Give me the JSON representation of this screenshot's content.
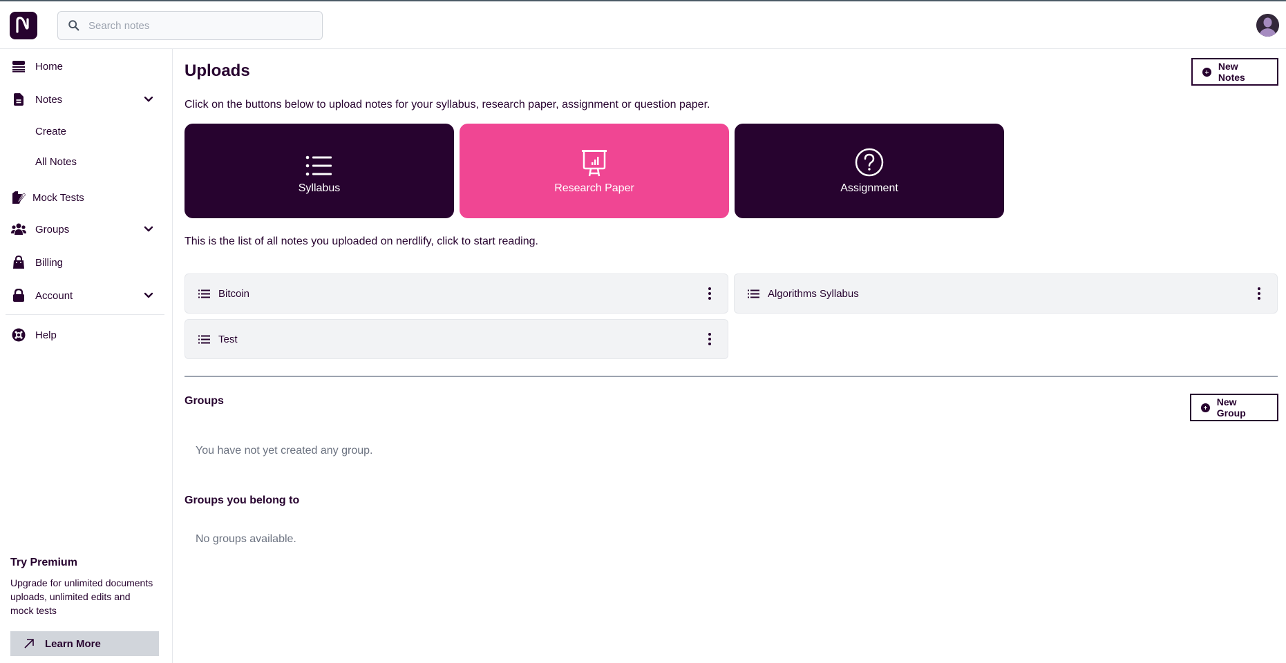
{
  "header": {
    "logo_letter": "N",
    "search": {
      "placeholder": "Search notes",
      "value": ""
    }
  },
  "sidebar": {
    "items": [
      {
        "label": "Home",
        "icon": "home-icon"
      },
      {
        "label": "Notes",
        "icon": "document-icon",
        "expandable": true,
        "expanded": true,
        "children": [
          {
            "label": "Create"
          },
          {
            "label": "All Notes"
          }
        ]
      },
      {
        "label": "Mock Tests",
        "icon": "edit-document-icon"
      },
      {
        "label": "Groups",
        "icon": "users-icon",
        "expandable": true
      },
      {
        "label": "Billing",
        "icon": "shopping-bag-icon"
      },
      {
        "label": "Account",
        "icon": "lock-icon",
        "expandable": true
      },
      {
        "label": "Help",
        "icon": "lifebuoy-icon"
      }
    ],
    "premium": {
      "title": "Try Premium",
      "description": "Upgrade for unlimited documents uploads, unlimited edits and mock tests",
      "button_label": "Learn More"
    }
  },
  "main": {
    "title": "Uploads",
    "new_notes_label": "New Notes",
    "intro": "Click on the buttons below to upload notes for your syllabus, research paper, assignment or question paper.",
    "upload_cards": [
      {
        "label": "Syllabus",
        "icon": "list-icon",
        "color": "#27032f"
      },
      {
        "label": "Research Paper",
        "icon": "presentation-chart-icon",
        "color": "#f04693"
      },
      {
        "label": "Assignment",
        "icon": "question-circle-icon",
        "color": "#27032f"
      }
    ],
    "list_intro": "This is the list of all notes you uploaded on nerdlify, click to start reading.",
    "notes": [
      {
        "title": "Bitcoin"
      },
      {
        "title": "Algorithms Syllabus"
      },
      {
        "title": "Test"
      }
    ],
    "groups": {
      "title": "Groups",
      "new_group_label": "New Group",
      "empty_text": "You have not yet created any group."
    },
    "belong": {
      "title": "Groups you belong to",
      "empty_text": "No groups available."
    }
  },
  "colors": {
    "brand_dark": "#27032f",
    "brand_pink": "#f04693",
    "muted_text": "#6b7280",
    "row_bg": "#f2f3f5"
  }
}
